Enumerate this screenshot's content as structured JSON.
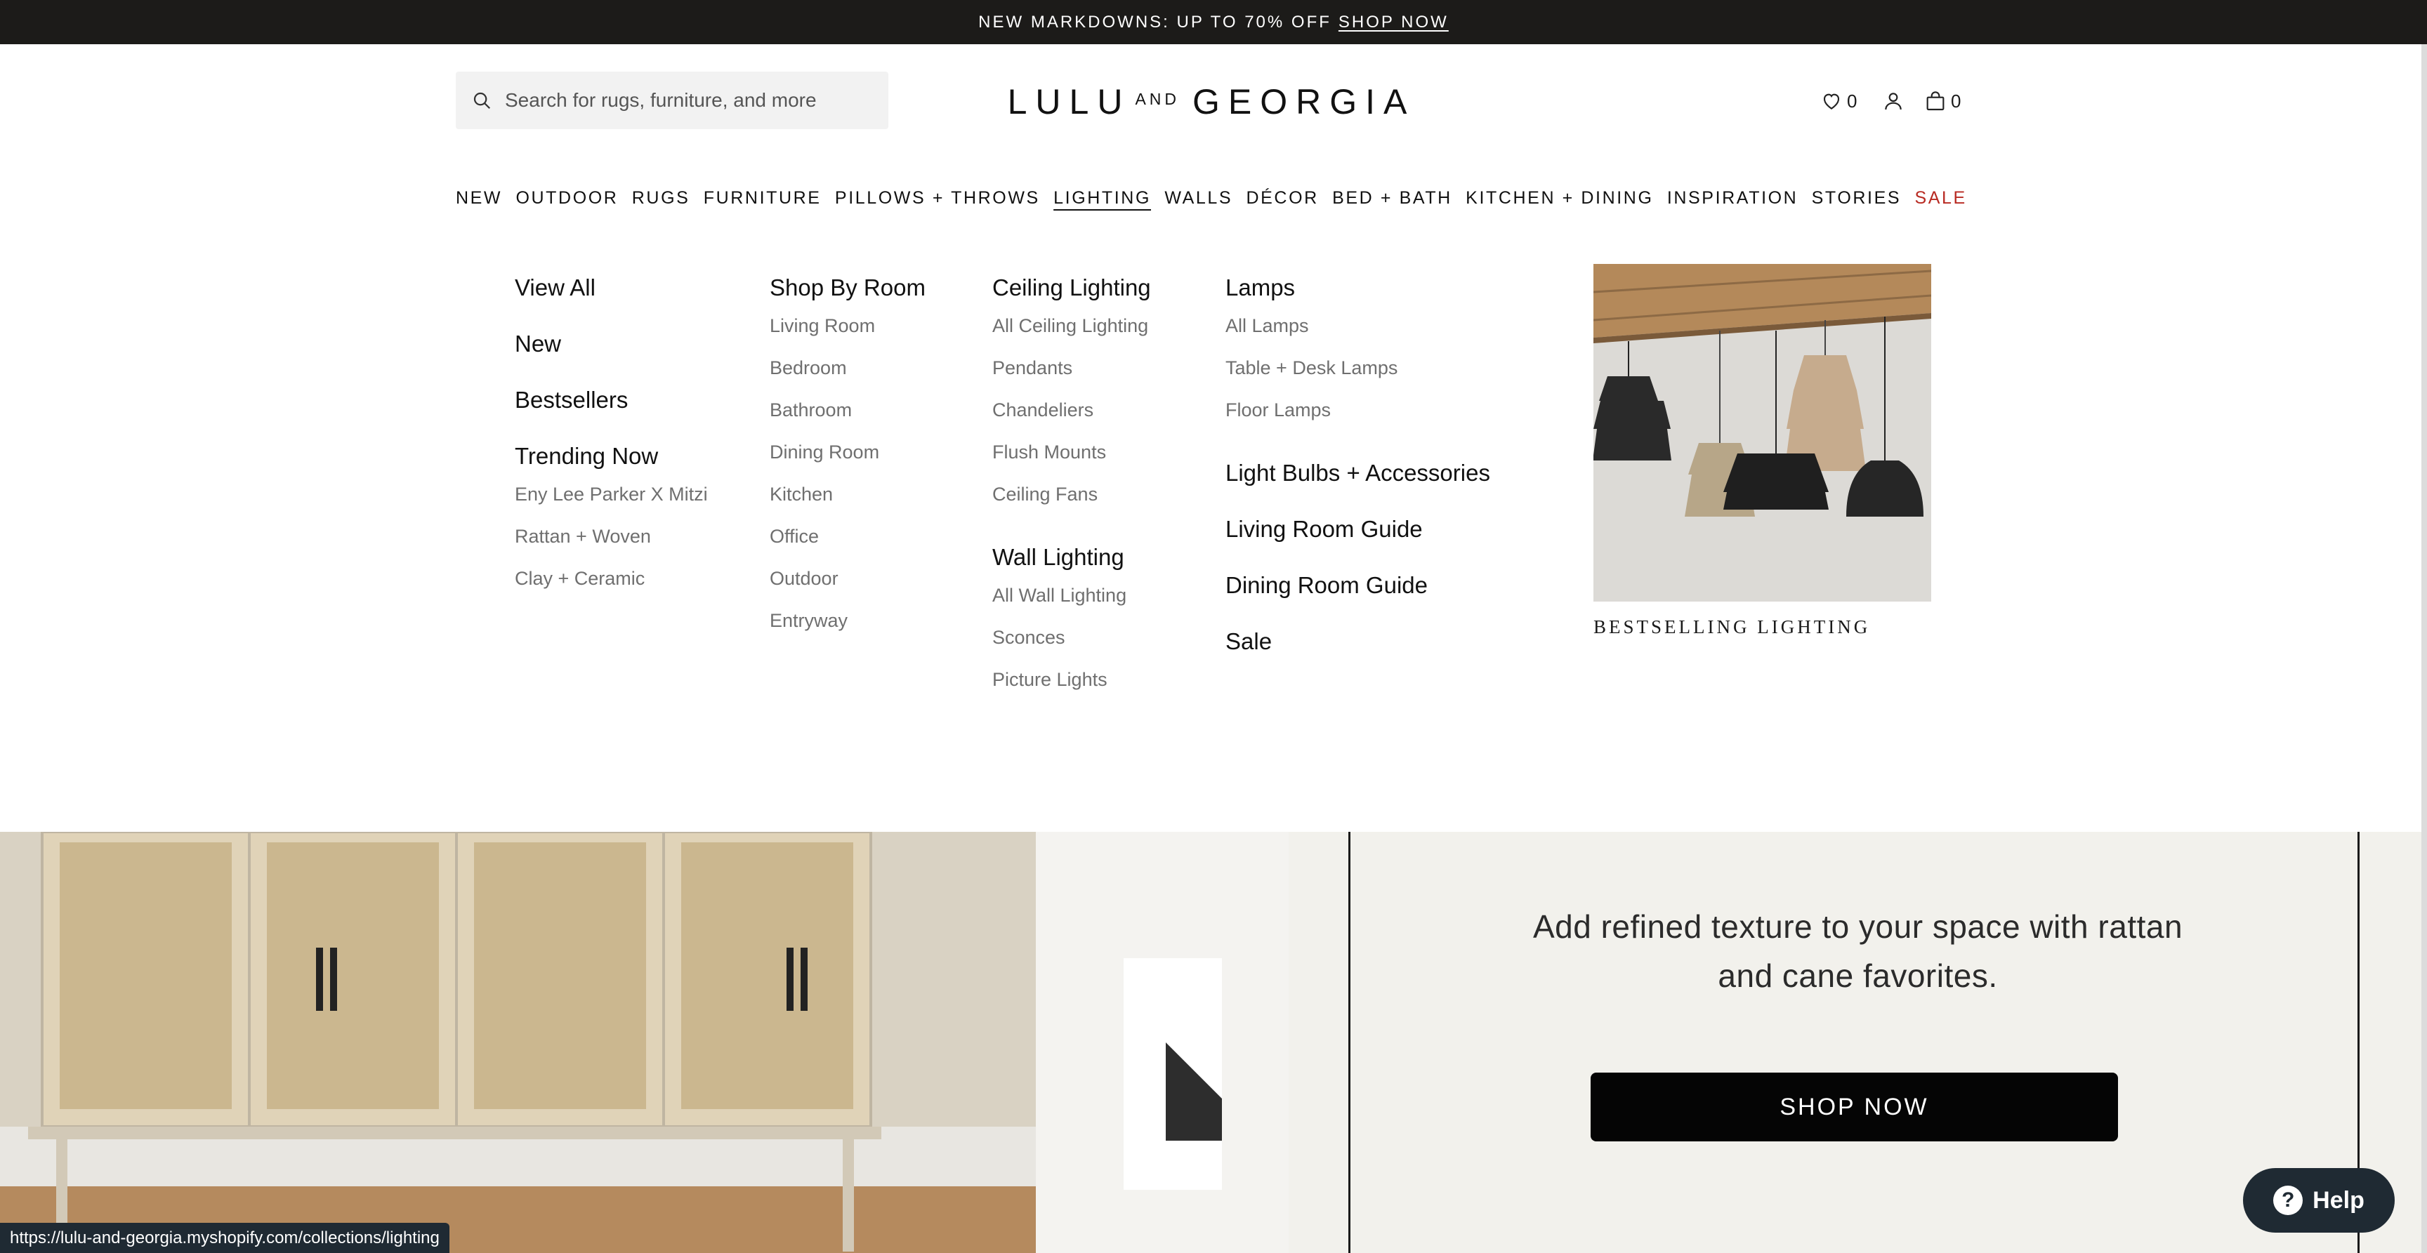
{
  "announcement": {
    "text": "NEW MARKDOWNS: UP TO 70% OFF",
    "link": "SHOP NOW"
  },
  "header": {
    "search_placeholder": "Search for rugs, furniture, and more",
    "logo": {
      "left": "LULU",
      "middle": "AND",
      "right": "GEORGIA"
    },
    "wishlist_count": "0",
    "cart_count": "0"
  },
  "nav": {
    "items": [
      "NEW",
      "OUTDOOR",
      "RUGS",
      "FURNITURE",
      "PILLOWS + THROWS",
      "LIGHTING",
      "WALLS",
      "DÉCOR",
      "BED + BATH",
      "KITCHEN + DINING",
      "INSPIRATION",
      "STORIES",
      "SALE"
    ],
    "active": "LIGHTING"
  },
  "menu": {
    "col1": {
      "view_all": "View All",
      "new": "New",
      "bestsellers": "Bestsellers",
      "trending": "Trending Now",
      "trending_items": [
        "Eny Lee Parker X Mitzi",
        "Rattan + Woven",
        "Clay + Ceramic"
      ]
    },
    "col2": {
      "heading": "Shop By Room",
      "items": [
        "Living Room",
        "Bedroom",
        "Bathroom",
        "Dining Room",
        "Kitchen",
        "Office",
        "Outdoor",
        "Entryway"
      ]
    },
    "col3": {
      "ceiling_heading": "Ceiling Lighting",
      "ceiling_items": [
        "All Ceiling Lighting",
        "Pendants",
        "Chandeliers",
        "Flush Mounts",
        "Ceiling Fans"
      ],
      "wall_heading": "Wall Lighting",
      "wall_items": [
        "All Wall Lighting",
        "Sconces",
        "Picture Lights"
      ]
    },
    "col4": {
      "lamps_heading": "Lamps",
      "lamps_items": [
        "All Lamps",
        "Table + Desk Lamps",
        "Floor Lamps"
      ],
      "bulbs": "Light Bulbs + Accessories",
      "living_guide": "Living Room Guide",
      "dining_guide": "Dining Room Guide",
      "sale": "Sale"
    },
    "promo_caption": "BESTSELLING LIGHTING"
  },
  "hero": {
    "line1": "Add refined texture to your space with rattan",
    "line2": "and cane favorites.",
    "button": "SHOP NOW"
  },
  "help_button": "Help",
  "status_url": "https://lulu-and-georgia.myshopify.com/collections/lighting",
  "colors": {
    "announcement_bg": "#1c1b19",
    "sale": "#b82a22",
    "button": "#050505",
    "help": "#1f2a33"
  }
}
